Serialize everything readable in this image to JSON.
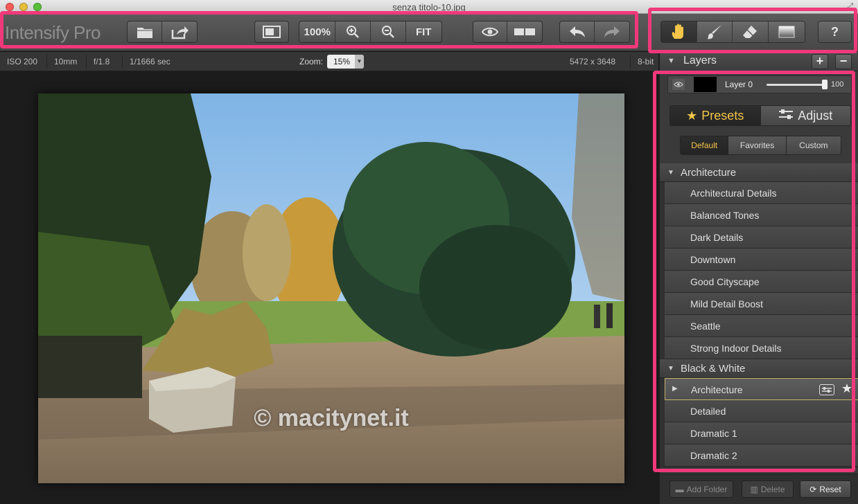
{
  "window": {
    "title": "senza titolo-10.jpg"
  },
  "toolbar": {
    "app_name": "Intensify Pro",
    "zoom_100_label": "100%",
    "fit_label": "FIT"
  },
  "info": {
    "iso": "ISO 200",
    "focal": "10mm",
    "aperture": "f/1.8",
    "shutter": "1/1666 sec",
    "zoom_label": "Zoom:",
    "zoom_value": "15%",
    "dimensions": "5472 x 3648",
    "bit_depth": "8-bit"
  },
  "canvas": {
    "watermark": "© macitynet.it"
  },
  "layers": {
    "title": "Layers",
    "add_label": "+",
    "remove_label": "−",
    "layer_name": "Layer 0",
    "opacity": "100"
  },
  "tabs": {
    "presets": "Presets",
    "adjust": "Adjust"
  },
  "subtabs": {
    "default": "Default",
    "favorites": "Favorites",
    "custom": "Custom"
  },
  "groups": [
    {
      "name": "Architecture",
      "items": [
        "Architectural Details",
        "Balanced Tones",
        "Dark Details",
        "Downtown",
        "Good Cityscape",
        "Mild Detail Boost",
        "Seattle",
        "Strong Indoor Details"
      ]
    },
    {
      "name": "Black & White",
      "items": [
        "Architecture",
        "Detailed",
        "Dramatic 1",
        "Dramatic 2"
      ]
    }
  ],
  "bottom": {
    "add_folder": "Add Folder",
    "delete": "Delete",
    "reset": "Reset"
  },
  "colors": {
    "highlight": "#f0397a",
    "accent": "#f3c548"
  }
}
